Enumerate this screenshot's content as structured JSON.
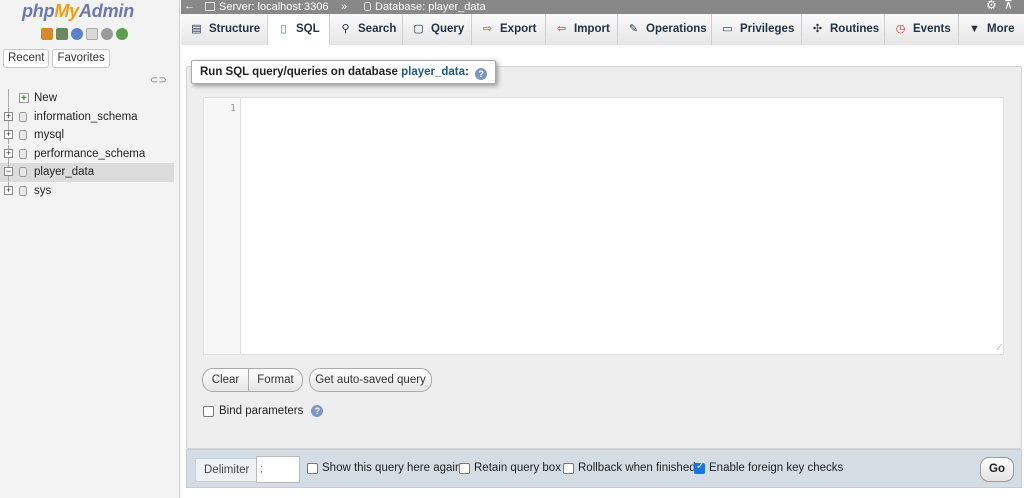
{
  "app": {
    "logo_php": "php",
    "logo_my": "My",
    "logo_admin": "Admin"
  },
  "nav": {
    "tabs": [
      "Recent",
      "Favorites"
    ],
    "tree": [
      {
        "label": "New",
        "expander": "",
        "selected": false
      },
      {
        "label": "information_schema",
        "expander": "+",
        "selected": false
      },
      {
        "label": "mysql",
        "expander": "+",
        "selected": false
      },
      {
        "label": "performance_schema",
        "expander": "+",
        "selected": false
      },
      {
        "label": "player_data",
        "expander": "−",
        "selected": true
      },
      {
        "label": "sys",
        "expander": "+",
        "selected": false
      }
    ]
  },
  "breadcrumb": {
    "back": "←",
    "server": "Server: localhost:3306",
    "separator": "»",
    "database": "Database: player_data"
  },
  "tabs": [
    {
      "label": "Structure",
      "icon": "structure-icon"
    },
    {
      "label": "SQL",
      "icon": "sql-icon"
    },
    {
      "label": "Search",
      "icon": "search-icon"
    },
    {
      "label": "Query",
      "icon": "query-icon"
    },
    {
      "label": "Export",
      "icon": "export-icon"
    },
    {
      "label": "Import",
      "icon": "import-icon"
    },
    {
      "label": "Operations",
      "icon": "wrench-icon"
    },
    {
      "label": "Privileges",
      "icon": "privileges-icon"
    },
    {
      "label": "Routines",
      "icon": "routines-icon"
    },
    {
      "label": "Events",
      "icon": "events-icon"
    },
    {
      "label": "More",
      "icon": "caret-down-icon"
    }
  ],
  "active_tab": "SQL",
  "sql": {
    "legend_prefix": "Run SQL query/queries on database",
    "database": "player_data",
    "legend_suffix": ":",
    "line_number": "1",
    "editor_value": "",
    "buttons": {
      "clear": "Clear",
      "format": "Format",
      "autosaved": "Get auto-saved query"
    },
    "bind_parameters": "Bind parameters",
    "bind_parameters_checked": false
  },
  "footer": {
    "delimiter_label": "Delimiter",
    "delimiter_value": ";",
    "options": [
      {
        "label": "Show this query here again",
        "checked": false
      },
      {
        "label": "Retain query box",
        "checked": false
      },
      {
        "label": "Rollback when finished",
        "checked": false
      },
      {
        "label": "Enable foreign key checks",
        "checked": true
      }
    ],
    "go": "Go"
  },
  "colors": {
    "accent": "#235a81",
    "breadcrumb_bg": "#888888",
    "footer_bg": "#d4dde4",
    "checkbox_checked": "#1a73e8"
  }
}
